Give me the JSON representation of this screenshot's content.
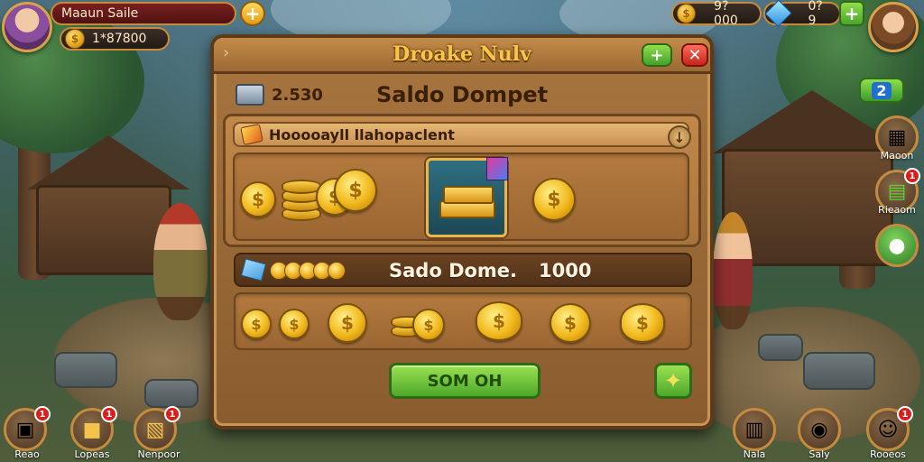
{
  "hud": {
    "player_name": "Maaun Saile",
    "player_coins": "1*87800",
    "gold_total": "9?000",
    "gems_total": "0?9",
    "right_badge": "2"
  },
  "icons": {
    "plus": "+",
    "close": "✕",
    "dollar": "$",
    "arrow": "›",
    "info": "↓",
    "sparkle": "✦"
  },
  "modal": {
    "title": "Droake Nulv",
    "wallet_value": "2.530",
    "wallet_title": "Saldo Dompet",
    "section1_title": "Hooooayll llahopaclent",
    "balance_label": "Sado Dome.",
    "balance_amount": "1000",
    "confirm_label": "SOM OH"
  },
  "side_right": [
    {
      "label": "Maoon",
      "badge": ""
    },
    {
      "label": "Rieaom",
      "badge": "1"
    },
    {
      "label": "",
      "badge": ""
    }
  ],
  "bottom_left": [
    {
      "label": "Reao",
      "badge": "1"
    },
    {
      "label": "Lopeas",
      "badge": "1"
    },
    {
      "label": "Nenpoor",
      "badge": "1"
    }
  ],
  "bottom_right": [
    {
      "label": "Nala",
      "badge": ""
    },
    {
      "label": "Saly",
      "badge": ""
    },
    {
      "label": "Rooeos",
      "badge": "1"
    }
  ],
  "colors": {
    "title_gold": "#f8c545",
    "panel_wood": "#a9743c",
    "confirm_green": "#4ea82a",
    "close_red": "#c82418"
  }
}
